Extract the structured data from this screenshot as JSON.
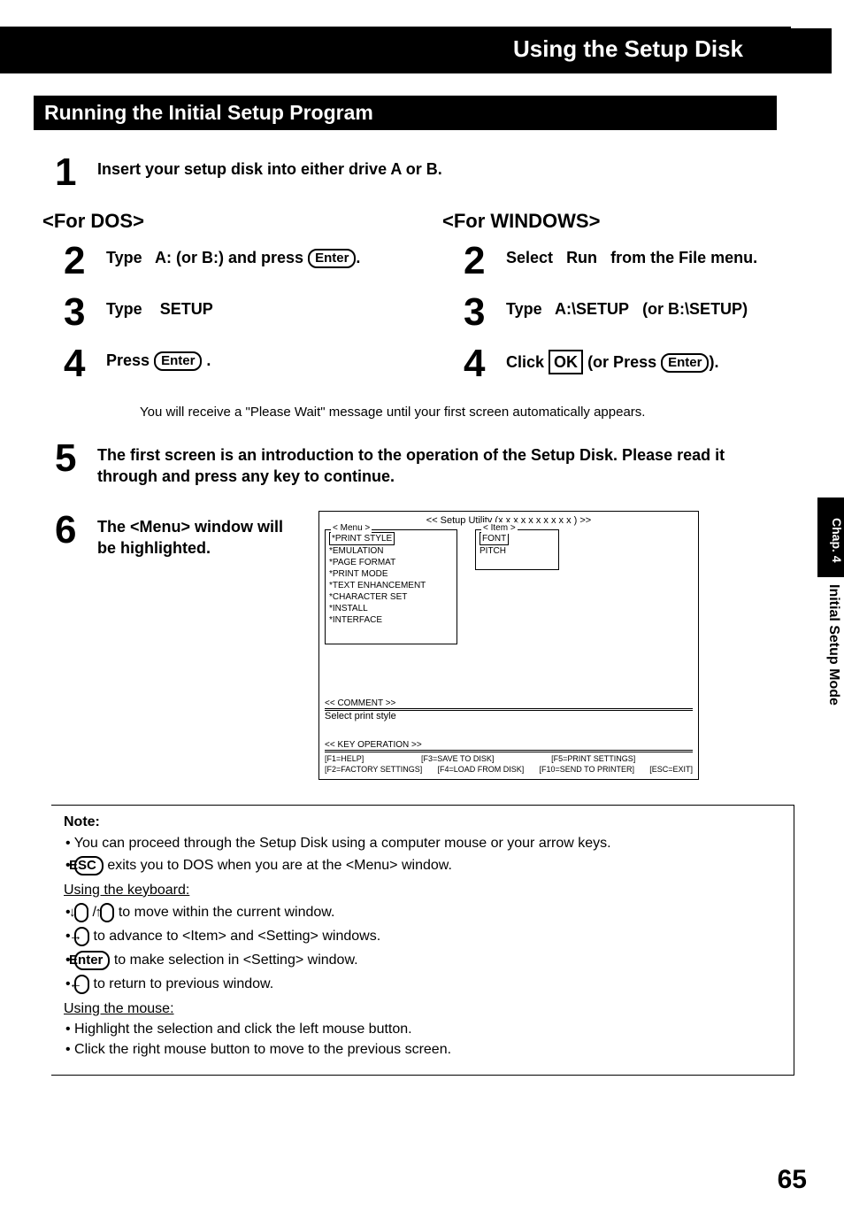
{
  "header": {
    "title": "Using the Setup Disk"
  },
  "section": {
    "title": "Running the Initial Setup Program"
  },
  "step1": {
    "num": "1",
    "text": "Insert your setup disk into either drive A or B."
  },
  "dos": {
    "header": "<For DOS>",
    "s2num": "2",
    "s2a": "Type",
    "s2b": "A:  (or  B:) and press",
    "s2key": "Enter",
    "s3num": "3",
    "s3a": "Type",
    "s3b": "SETUP",
    "s4num": "4",
    "s4a": "Press",
    "s4key": "Enter",
    "s4b": "."
  },
  "win": {
    "header": "<For WINDOWS>",
    "s2num": "2",
    "s2a": "Select",
    "s2b": "Run",
    "s2c": "from the File menu.",
    "s3num": "3",
    "s3a": "Type",
    "s3b": "A:\\SETUP",
    "s3c": "(or B:\\SETUP)",
    "s4num": "4",
    "s4a": "Click",
    "s4ok": "OK",
    "s4b": "(or Press",
    "s4key": "Enter",
    "s4c": ")."
  },
  "wait_note": "You will receive a \"Please Wait\" message until your first screen automatically appears.",
  "step5": {
    "num": "5",
    "text": "The first screen is an introduction to the operation of the Setup Disk. Please read it through and press any key to continue."
  },
  "step6": {
    "num": "6",
    "text": "The <Menu> window will be highlighted."
  },
  "diagram": {
    "title": "<<  Setup Utility (x x x x x x   x x x x ) >>",
    "menu_label": "< Menu >",
    "item_label": "< Item >",
    "menu_items": [
      "*PRINT STYLE",
      "*EMULATION",
      "*PAGE FORMAT",
      "*PRINT MODE",
      "*TEXT ENHANCEMENT",
      "*CHARACTER SET",
      "*INSTALL",
      "*INTERFACE"
    ],
    "item_items": [
      "FONT",
      "PITCH"
    ],
    "comment_label": "<< COMMENT >>",
    "comment_text": "Select print style",
    "keyop_label": "<< KEY OPERATION >>",
    "keyop_row1": [
      "[F1=HELP]",
      "[F3=SAVE TO DISK]",
      "[F5=PRINT SETTINGS]"
    ],
    "keyop_row2": [
      "[F2=FACTORY SETTINGS]",
      "[F4=LOAD FROM DISK]",
      "[F10=SEND TO PRINTER]",
      "[ESC=EXIT]"
    ]
  },
  "note": {
    "title": "Note:",
    "b1": "You can proceed through the Setup Disk using a computer mouse or your arrow keys.",
    "b2key": "ESC",
    "b2": " exits you to DOS when you are at the <Menu> window.",
    "kb_head": "Using the keyboard:",
    "kb1a": "↓",
    "kb1b": "↑",
    "kb1t": " to move within the current window.",
    "kb2a": "→",
    "kb2t": " to advance to <Item> and <Setting> windows.",
    "kb3a": "Enter",
    "kb3t": " to make selection in <Setting> window.",
    "kb4a": "←",
    "kb4t": " to return to previous window.",
    "mouse_head": "Using the mouse:",
    "m1": "Highlight the selection and click the left mouse button.",
    "m2": "Click the right mouse button to move to the previous screen."
  },
  "side": {
    "tab": "Chap. 4",
    "label": "Initial Setup Mode"
  },
  "page_num": "65"
}
